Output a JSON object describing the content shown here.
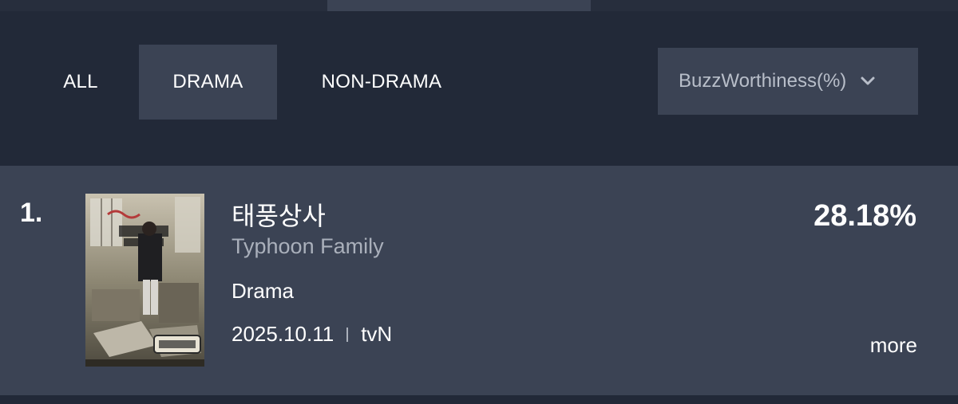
{
  "filters": {
    "all": "ALL",
    "drama": "DRAMA",
    "non_drama": "NON-DRAMA",
    "active": "DRAMA"
  },
  "sort": {
    "selected": "BuzzWorthiness(%)",
    "icon": "chevron-down-icon"
  },
  "colors": {
    "background": "#1f2533",
    "panel": "#3b4354",
    "text_muted": "#aab0bb"
  },
  "items": [
    {
      "rank": "1.",
      "title_ko": "태풍상사",
      "title_en": "Typhoon Family",
      "genre": "Drama",
      "date": "2025.10.11",
      "channel": "tvN",
      "score": "28.18%",
      "more_label": "more"
    }
  ]
}
